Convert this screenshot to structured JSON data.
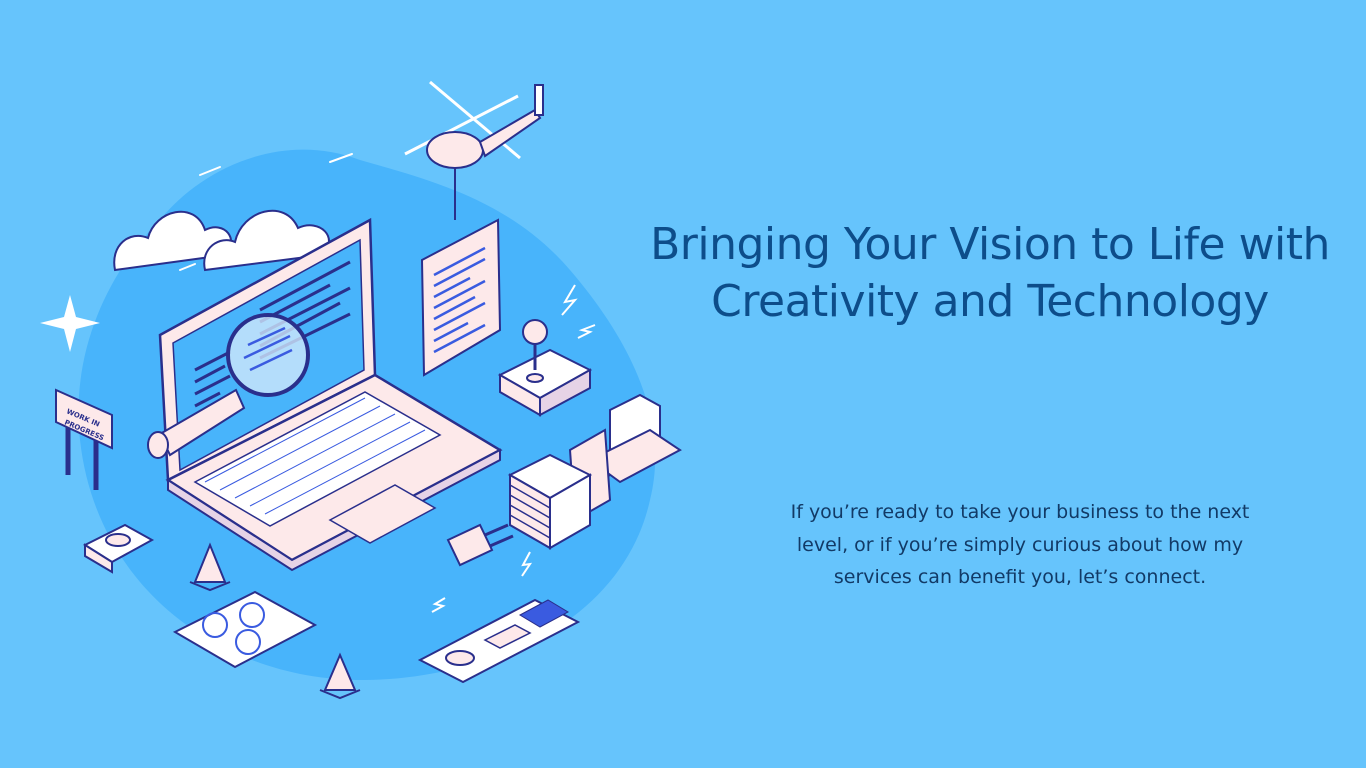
{
  "page": {
    "background_color": "#66c4fc"
  },
  "hero": {
    "headline": "Bringing Your Vision to Life with Creativity and Technology",
    "body": "If you’re ready to take your business to the next level, or if you’re simply curious about how my services can benefit you, let’s connect.",
    "headline_color": "#0d4d8a",
    "body_color": "#123a66"
  },
  "illustration": {
    "sign_text_line1": "WORK IN",
    "sign_text_line2": "PROGRESS",
    "blob_color": "#48b4fb",
    "line_color": "#2a2f8c",
    "fill_color": "#fde9ea",
    "accent_color": "#3a5be0"
  }
}
